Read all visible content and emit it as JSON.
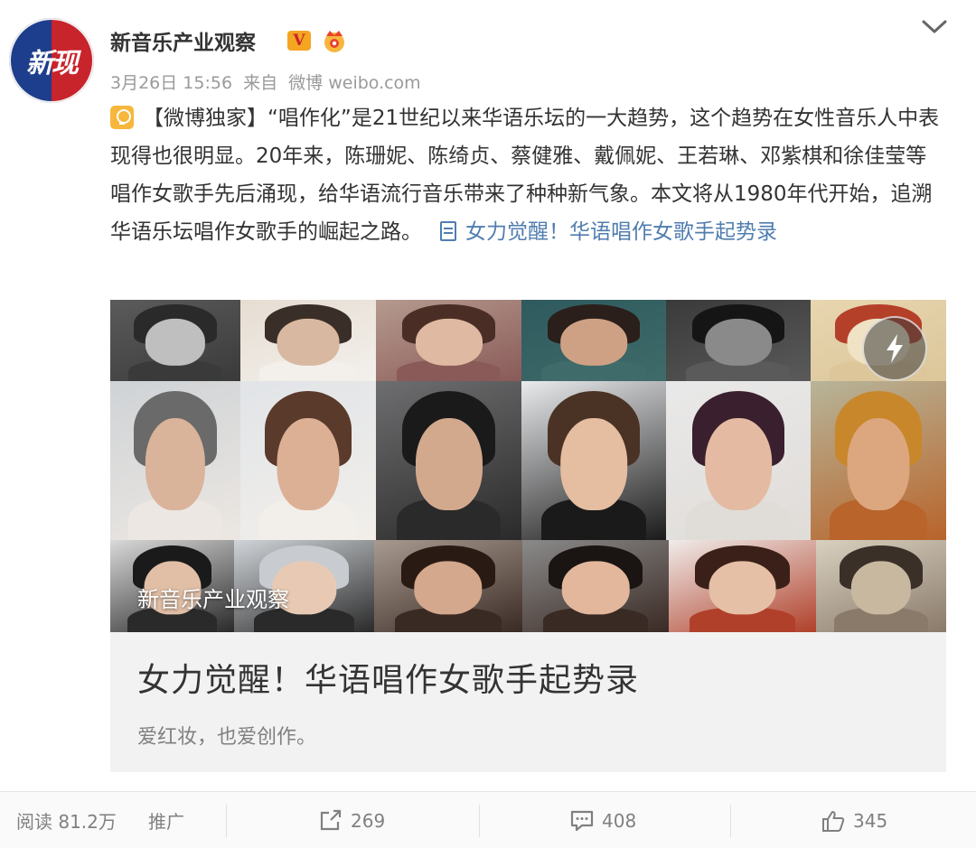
{
  "header": {
    "user_name": "新音乐产业观察",
    "avatar_text": "新现",
    "verified_badge": "V",
    "post_date": "3月26日 15:56",
    "source_prefix": "来自",
    "source": "微博 weibo.com"
  },
  "post": {
    "tag": "【微博独家】",
    "body": "“唱作化”是21世纪以来华语乐坛的一大趋势，这个趋势在女性音乐人中表现得也很明显。20年来，陈珊妮、陈绮贞、蔡健雅、戴佩妮、王若琳、邓紫棋和徐佳莹等唱作女歌手先后涌现，给华语流行音乐带来了种种新气象。本文将从1980年代开始，追溯华语乐坛唱作女歌手的崛起之路。",
    "article_link": "女力觉醒！华语唱作女歌手起势录"
  },
  "card": {
    "watermark": "新音乐产业观察",
    "title": "女力觉醒！华语唱作女歌手起势录",
    "summary": "爱红妆，也爱创作。"
  },
  "footer": {
    "reads_label": "阅读",
    "reads_value": "81.2万",
    "promote_label": "推广",
    "reposts": "269",
    "comments": "408",
    "likes": "345"
  },
  "colors": {
    "link": "#507daf",
    "text": "#333333",
    "meta": "#9a9a9a",
    "badge": "#f4a521"
  }
}
